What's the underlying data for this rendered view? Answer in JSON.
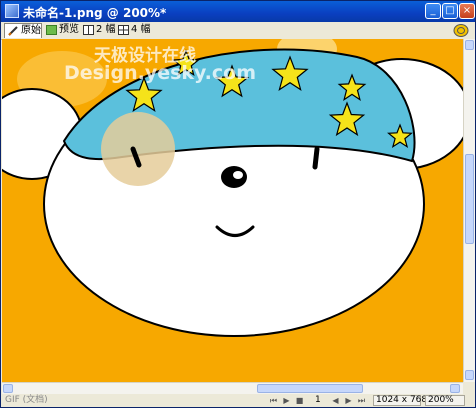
{
  "window": {
    "title": "未命名-1.png @ 200%*"
  },
  "title_buttons": {
    "minimize": "_",
    "maximize": "□",
    "close": "×"
  },
  "toolbar": {
    "tabs": [
      {
        "label": "原始"
      },
      {
        "label": "预览"
      },
      {
        "label": "2 幅"
      },
      {
        "label": "4 幅"
      }
    ]
  },
  "watermark": {
    "line1": "天极设计在线",
    "line2": "Design.yesky.com"
  },
  "statusbar": {
    "format": "GIF (文档)",
    "page": "1",
    "dimensions": "1024 x 768",
    "zoom": "200%"
  },
  "colors": {
    "canvas_background": "#f7a800",
    "hat": "#5bc0dc",
    "star": "#f5e31a",
    "cheek": "#e5cc9a"
  }
}
